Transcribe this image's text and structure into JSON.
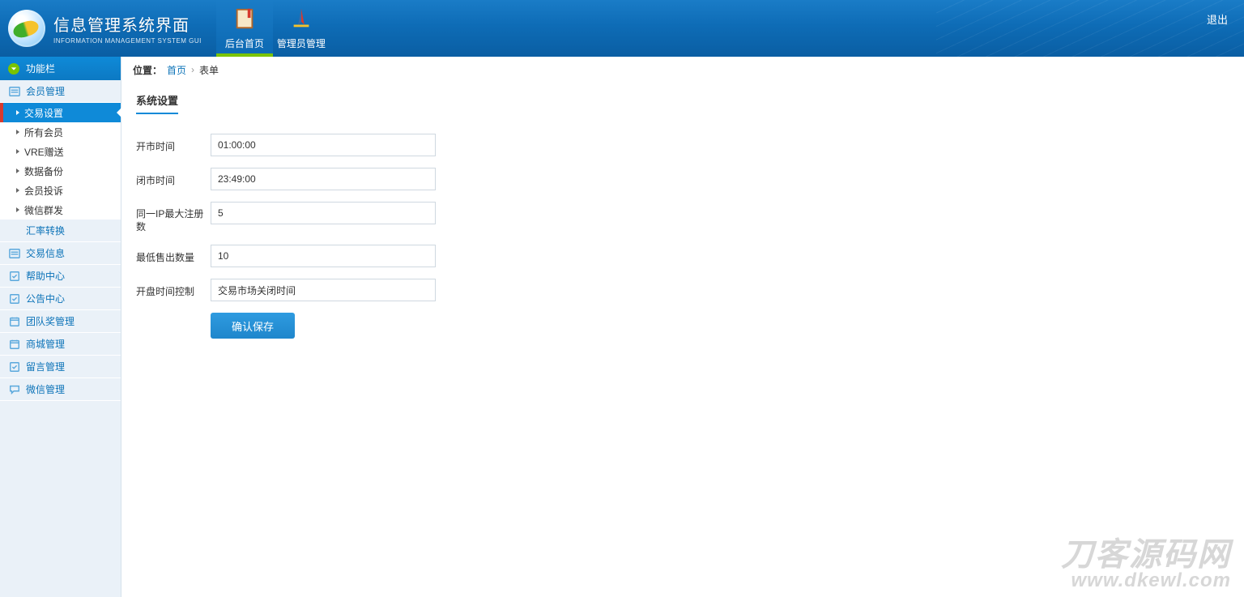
{
  "header": {
    "title_cn": "信息管理系统界面",
    "title_en": "INFORMATION MANAGEMENT SYSTEM GUI",
    "tabs": [
      {
        "label": "后台首页"
      },
      {
        "label": "管理员管理"
      }
    ],
    "logout": "退出"
  },
  "sidebar": {
    "header": "功能栏",
    "groups": [
      {
        "label": "会员管理",
        "icon": "list-icon",
        "subs": [
          {
            "label": "交易设置",
            "active": true
          },
          {
            "label": "所有会员"
          },
          {
            "label": "VRE赠送"
          },
          {
            "label": "数据备份"
          },
          {
            "label": "会员投诉"
          },
          {
            "label": "微信群发"
          }
        ]
      },
      {
        "label": "汇率转换",
        "icon": "chat-icon"
      },
      {
        "label": "交易信息",
        "icon": "list-icon"
      },
      {
        "label": "帮助中心",
        "icon": "edit-icon"
      },
      {
        "label": "公告中心",
        "icon": "edit-icon"
      },
      {
        "label": "团队奖管理",
        "icon": "calendar-icon"
      },
      {
        "label": "商城管理",
        "icon": "calendar-icon"
      },
      {
        "label": "留言管理",
        "icon": "edit-icon"
      },
      {
        "label": "微信管理",
        "icon": "chat-icon"
      }
    ]
  },
  "breadcrumb": {
    "prefix": "位置：",
    "items": [
      "首页",
      "表单"
    ]
  },
  "panel": {
    "title": "系统设置",
    "fields": {
      "open_time": {
        "label": "开市时间",
        "value": "01:00:00"
      },
      "close_time": {
        "label": "闭市时间",
        "value": "23:49:00"
      },
      "max_ip_reg": {
        "label": "同一IP最大注册数",
        "value": "5"
      },
      "min_sell_qty": {
        "label": "最低售出数量",
        "value": "10"
      },
      "market_ctrl": {
        "label": "开盘时间控制",
        "value": "交易市场关闭时间"
      }
    },
    "submit": "确认保存"
  },
  "watermark": {
    "l1": "刀客源码网",
    "l2": "www.dkewl.com"
  }
}
